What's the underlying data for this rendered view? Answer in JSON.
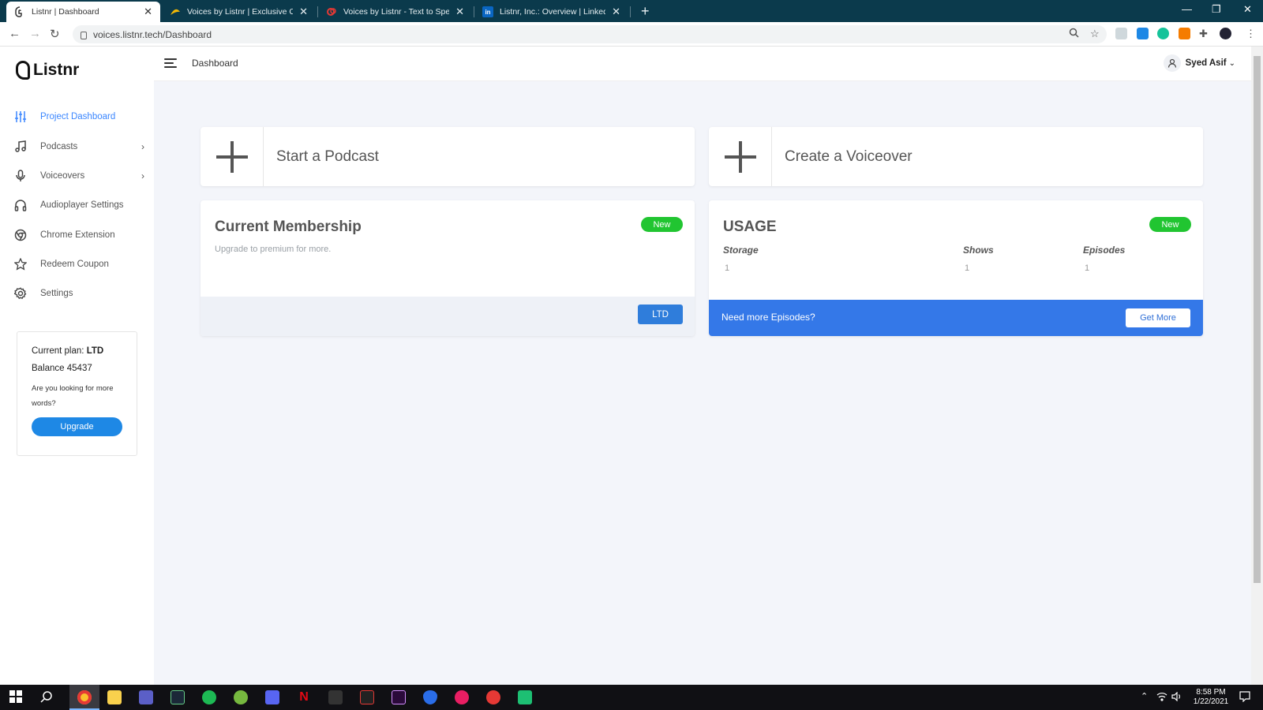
{
  "browser": {
    "tabs": [
      {
        "title": "Listnr | Dashboard",
        "active": true
      },
      {
        "title": "Voices by Listnr | Exclusive Offer f",
        "active": false
      },
      {
        "title": "Voices by Listnr - Text to Speech",
        "active": false
      },
      {
        "title": "Listnr, Inc.: Overview | LinkedIn",
        "active": false
      }
    ],
    "url": "voices.listnr.tech/Dashboard"
  },
  "sidebar": {
    "logo": "Listnr",
    "items": [
      {
        "label": "Project Dashboard",
        "icon": "sliders-icon",
        "active": true
      },
      {
        "label": "Podcasts",
        "icon": "music-note-icon",
        "has_children": true
      },
      {
        "label": "Voiceovers",
        "icon": "microphone-icon",
        "has_children": true
      },
      {
        "label": "Audioplayer Settings",
        "icon": "headphones-icon"
      },
      {
        "label": "Chrome Extension",
        "icon": "chrome-icon"
      },
      {
        "label": "Redeem Coupon",
        "icon": "star-icon"
      },
      {
        "label": "Settings",
        "icon": "gear-icon"
      }
    ],
    "plan": {
      "plan_label": "Current plan:",
      "plan_value": "LTD",
      "balance_label": "Balance",
      "balance_value": "45437",
      "prompt": "Are you looking for more words?",
      "upgrade_label": "Upgrade"
    }
  },
  "header": {
    "title": "Dashboard",
    "user": "Syed Asif"
  },
  "main": {
    "start_podcast": "Start a Podcast",
    "create_voiceover": "Create a Voiceover",
    "membership": {
      "title": "Current Membership",
      "badge": "New",
      "subtitle": "Upgrade to premium for more.",
      "button": "LTD"
    },
    "usage": {
      "title": "USAGE",
      "badge": "New",
      "stats": [
        {
          "label": "Storage",
          "value": "1"
        },
        {
          "label": "Shows",
          "value": "1"
        },
        {
          "label": "Episodes",
          "value": "1"
        }
      ],
      "footer_text": "Need more Episodes?",
      "footer_button": "Get More"
    }
  },
  "taskbar": {
    "time": "8:58 PM",
    "date": "1/22/2021"
  },
  "colors": {
    "accent": "#3a86ff",
    "badge_green": "#21c531",
    "usage_blue": "#3478e8",
    "tabbar": "#0b3a4c",
    "main_bg": "#f3f5fa"
  }
}
